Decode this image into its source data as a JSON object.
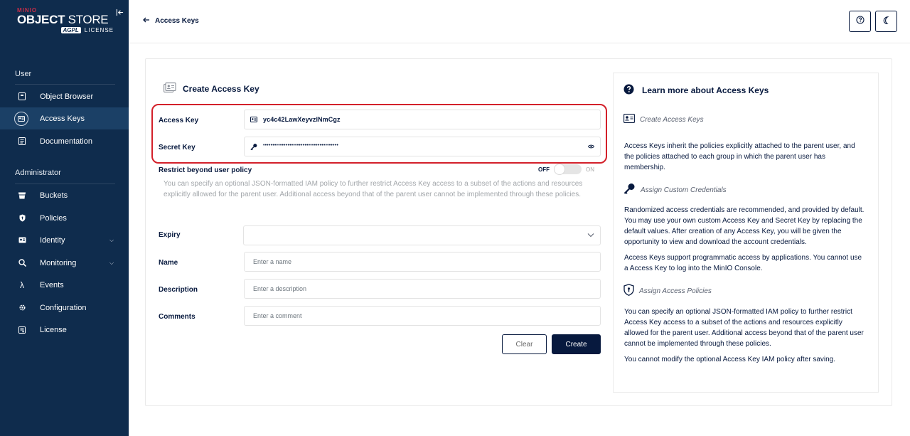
{
  "sidebar": {
    "logo": {
      "brand": "MINIO",
      "product_bold": "OBJECT",
      "product_thin": " STORE",
      "badge": "AGPL",
      "license": "LICENSE"
    },
    "sections": {
      "user": "User",
      "admin": "Administrator"
    },
    "items": [
      {
        "label": "Object Browser",
        "icon": "folder-icon"
      },
      {
        "label": "Access Keys",
        "icon": "id-card-icon",
        "active": true
      },
      {
        "label": "Documentation",
        "icon": "book-icon"
      },
      {
        "label": "Buckets",
        "icon": "bucket-icon"
      },
      {
        "label": "Policies",
        "icon": "shield-icon"
      },
      {
        "label": "Identity",
        "icon": "identity-icon",
        "expandable": true
      },
      {
        "label": "Monitoring",
        "icon": "monitoring-icon",
        "expandable": true
      },
      {
        "label": "Events",
        "icon": "lambda-icon"
      },
      {
        "label": "Configuration",
        "icon": "gear-icon"
      },
      {
        "label": "License",
        "icon": "license-icon"
      }
    ]
  },
  "header": {
    "back_label": "Access Keys"
  },
  "form": {
    "title": "Create Access Key",
    "access_key_label": "Access Key",
    "access_key_value": "yc4c42LawXeyvzlNmCgz",
    "secret_key_label": "Secret Key",
    "secret_key_value": "••••••••••••••••••••••••••••••••••••••••",
    "restrict_label": "Restrict beyond user policy",
    "toggle_off": "OFF",
    "toggle_on": "ON",
    "restrict_desc": "You can specify an optional JSON-formatted IAM policy to further restrict Access Key access to a subset of the actions and resources explicitly allowed for the parent user. Additional access beyond that of the parent user cannot be implemented through these policies.",
    "expiry_label": "Expiry",
    "name_label": "Name",
    "name_placeholder": "Enter a name",
    "description_label": "Description",
    "description_placeholder": "Enter a description",
    "comments_label": "Comments",
    "comments_placeholder": "Enter a comment",
    "clear_label": "Clear",
    "create_label": "Create"
  },
  "help": {
    "title": "Learn more about Access Keys",
    "sub1": "Create Access Keys",
    "p1": "Access Keys inherit the policies explicitly attached to the parent user, and the policies attached to each group in which the parent user has membership.",
    "sub2": "Assign Custom Credentials",
    "p2": "Randomized access credentials are recommended, and provided by default. You may use your own custom Access Key and Secret Key by replacing the default values. After creation of any Access Key, you will be given the opportunity to view and download the account credentials.",
    "p3": "Access Keys support programmatic access by applications. You cannot use a Access Key to log into the MinIO Console.",
    "sub3": "Assign Access Policies",
    "p4": "You can specify an optional JSON-formatted IAM policy to further restrict Access Key access to a subset of the actions and resources explicitly allowed for the parent user. Additional access beyond that of the parent user cannot be implemented through these policies.",
    "p5": "You cannot modify the optional Access Key IAM policy after saving."
  },
  "colors": {
    "sidebar": "#0f2c4d",
    "sidebar_active": "#1b4066",
    "primary": "#07193e",
    "highlight": "#d3202a",
    "brand_red": "#c72c48"
  }
}
